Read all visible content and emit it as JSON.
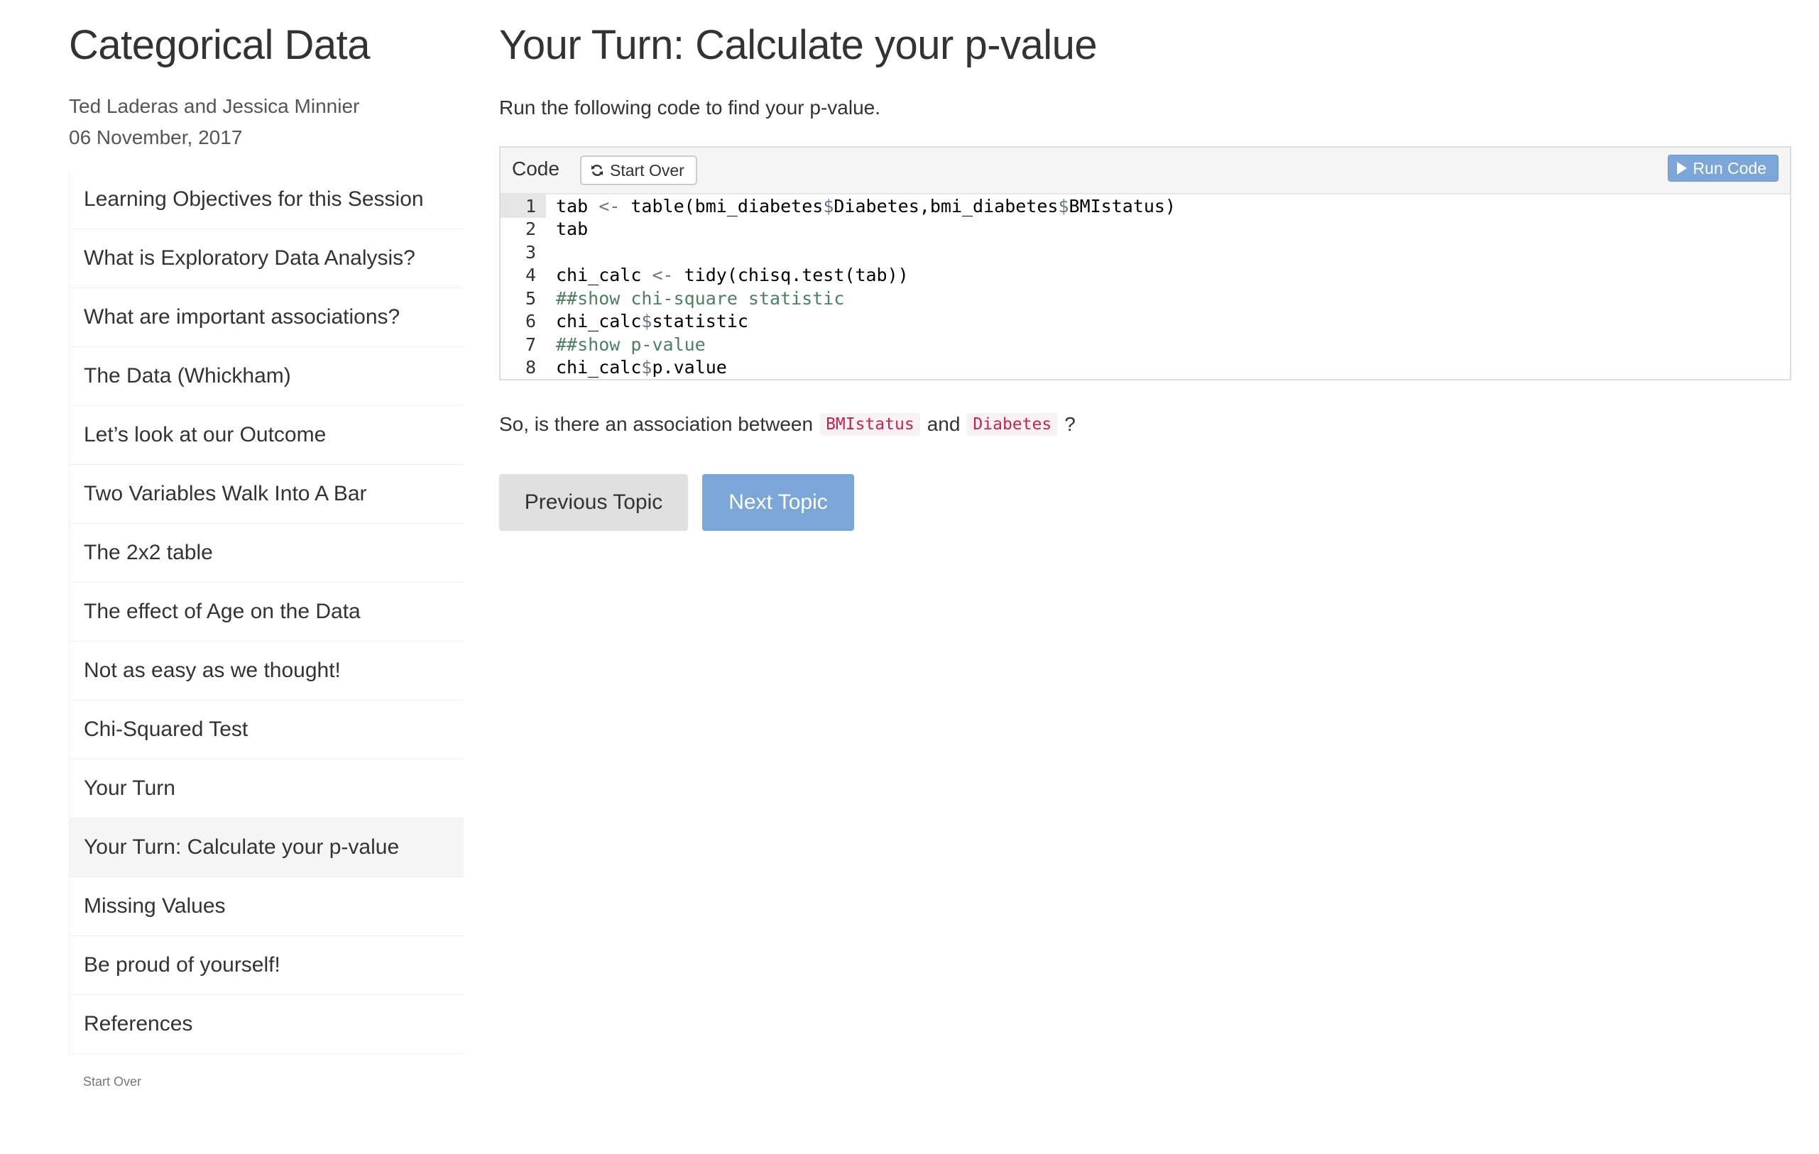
{
  "sidebar": {
    "title": "Categorical Data",
    "authors": "Ted Laderas and Jessica Minnier",
    "date": "06 November, 2017",
    "topics": [
      "Learning Objectives for this Session",
      "What is Exploratory Data Analysis?",
      "What are important associations?",
      "The Data (Whickham)",
      "Let’s look at our Outcome",
      "Two Variables Walk Into A Bar",
      "The 2x2 table",
      "The effect of Age on the Data",
      "Not as easy as we thought!",
      "Chi-Squared Test",
      "Your Turn",
      "Your Turn: Calculate your p-value",
      "Missing Values",
      "Be proud of yourself!",
      "References"
    ],
    "active_topic": "Your Turn: Calculate your p-value",
    "start_over_label": "Start Over"
  },
  "main": {
    "title": "Your Turn: Calculate your p-value",
    "intro": "Run the following code to find your p-value.",
    "exercise": {
      "label": "Code",
      "start_over_label": "Start Over",
      "run_label": "Run Code",
      "lines": [
        {
          "num": "1",
          "text": "tab <- table(bmi_diabetes$Diabetes,bmi_diabetes$BMIstatus)"
        },
        {
          "num": "2",
          "text": "tab"
        },
        {
          "num": "3",
          "text": ""
        },
        {
          "num": "4",
          "text": "chi_calc <- tidy(chisq.test(tab))"
        },
        {
          "num": "5",
          "text": "##show chi-square statistic"
        },
        {
          "num": "6",
          "text": "chi_calc$statistic"
        },
        {
          "num": "7",
          "text": "##show p-value"
        },
        {
          "num": "8",
          "text": "chi_calc$p.value"
        }
      ]
    },
    "question": {
      "prefix": "So, is there an association between",
      "var1": "BMIstatus",
      "middle": "and",
      "var2": "Diabetes",
      "suffix": "?"
    },
    "prev_label": "Previous Topic",
    "next_label": "Next Topic"
  },
  "icons": {
    "start_over": "refresh-icon",
    "run": "play-icon"
  },
  "colors": {
    "accent": "#7aa6d8",
    "inline_code": "#c7254e",
    "comment": "#4d8060"
  }
}
